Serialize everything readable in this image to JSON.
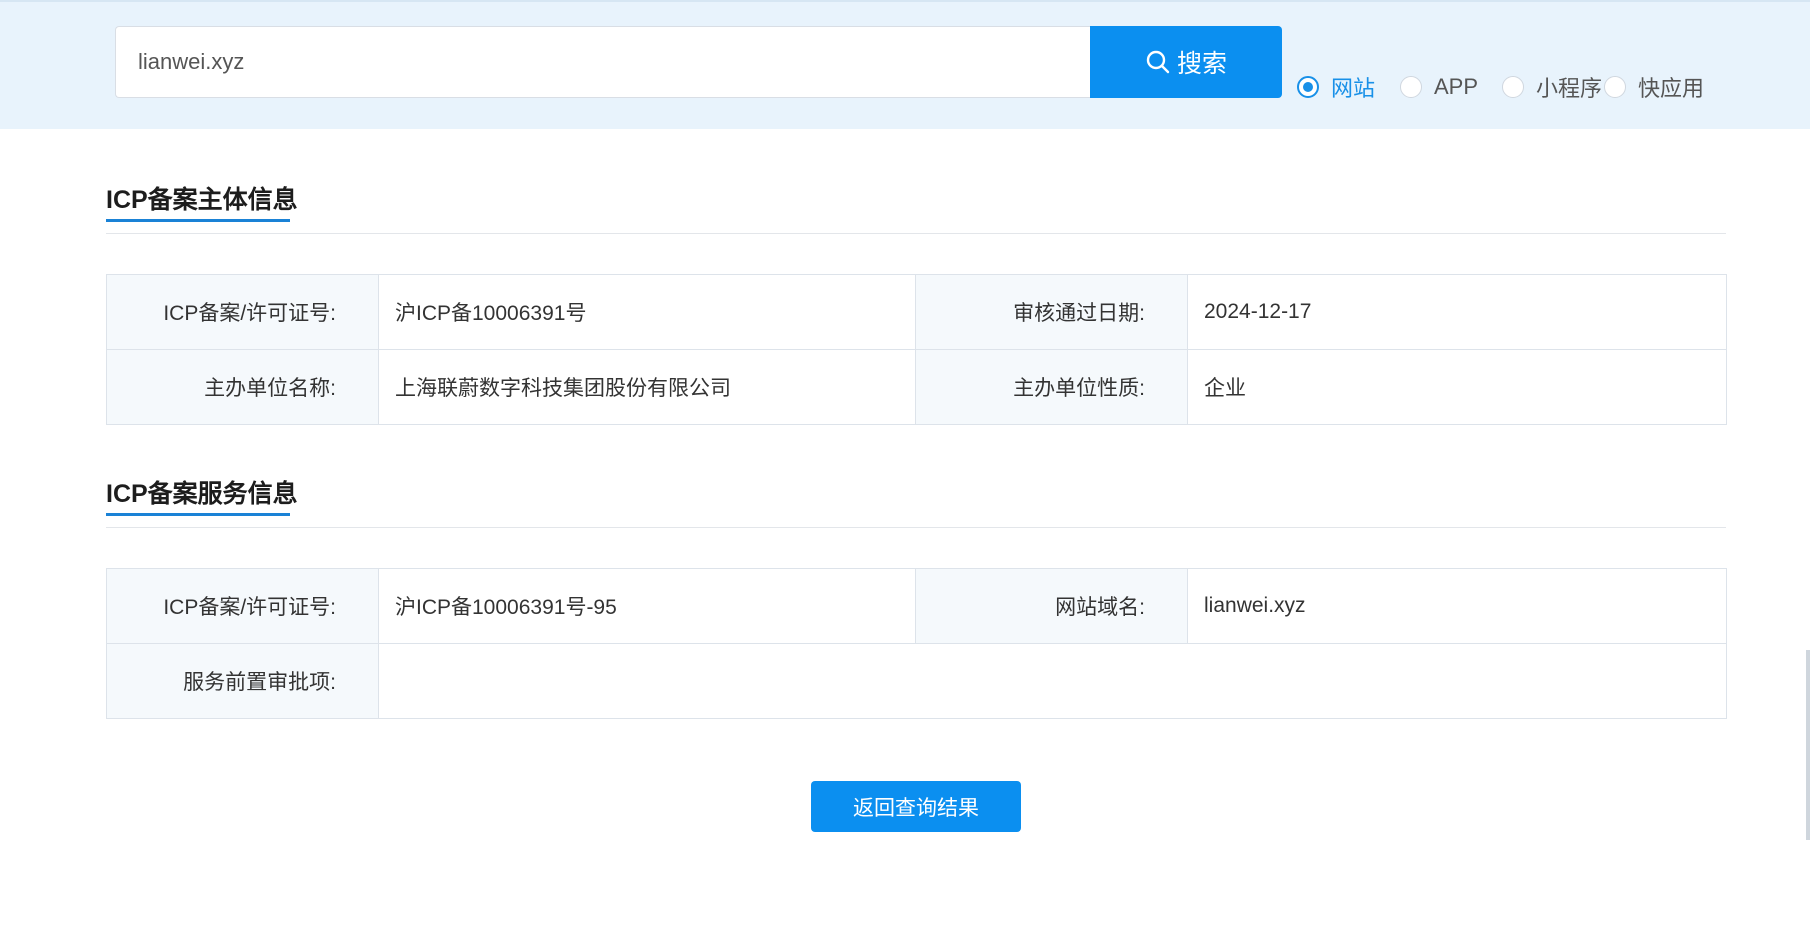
{
  "search": {
    "query": "lianwei.xyz",
    "button_label": "搜索",
    "options": [
      {
        "label": "网站",
        "checked": true
      },
      {
        "label": "APP",
        "checked": false
      },
      {
        "label": "小程序",
        "checked": false
      },
      {
        "label": "快应用",
        "checked": false
      }
    ]
  },
  "entity_section": {
    "title": "ICP备案主体信息",
    "rows": [
      [
        {
          "label": "ICP备案/许可证号:",
          "value": "沪ICP备10006391号"
        },
        {
          "label": "审核通过日期:",
          "value": "2024-12-17"
        }
      ],
      [
        {
          "label": "主办单位名称:",
          "value": "上海联蔚数字科技集团股份有限公司"
        },
        {
          "label": "主办单位性质:",
          "value": "企业"
        }
      ]
    ]
  },
  "service_section": {
    "title": "ICP备案服务信息",
    "rows": [
      [
        {
          "label": "ICP备案/许可证号:",
          "value": "沪ICP备10006391号-95"
        },
        {
          "label": "网站域名:",
          "value": "lianwei.xyz"
        }
      ],
      [
        {
          "label": "服务前置审批项:",
          "value": ""
        }
      ]
    ]
  },
  "back_button_label": "返回查询结果",
  "colors": {
    "accent": "#0b8ff0",
    "band": "#e8f3fc",
    "label_bg": "#f5f9fc"
  }
}
